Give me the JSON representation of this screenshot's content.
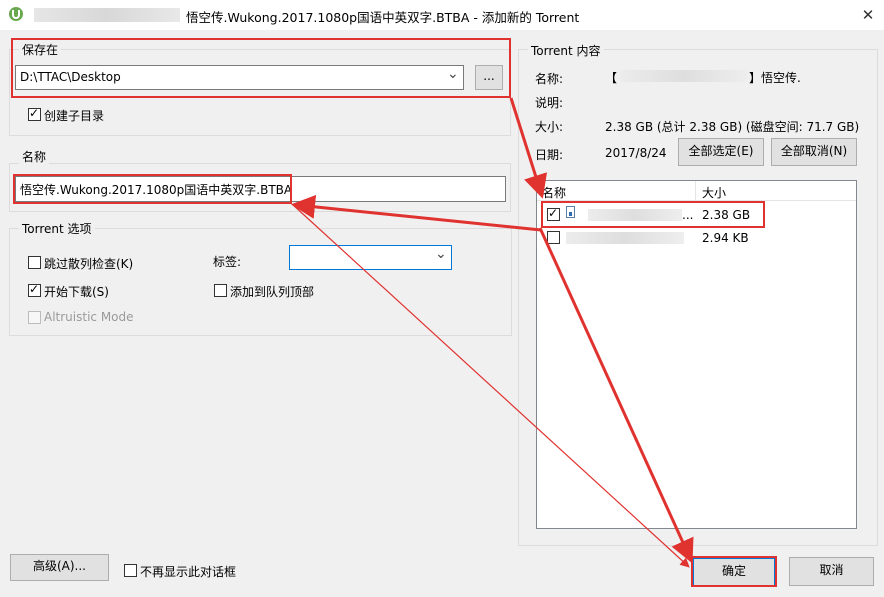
{
  "window": {
    "title": "悟空传.Wukong.2017.1080p国语中英双字.BTBA - 添加新的 Torrent",
    "close_glyph": "✕"
  },
  "save_in": {
    "legend": "保存在",
    "path": "D:\\TTAC\\Desktop",
    "browse_label": "...",
    "dropdown_glyph": "⌄",
    "create_subdir_label": "创建子目录",
    "create_subdir_checked": true
  },
  "name_section": {
    "legend": "名称",
    "value": "悟空传.Wukong.2017.1080p国语中英双字.BTBA"
  },
  "options": {
    "legend": "Torrent 选项",
    "skip_check_label": "跳过散列检查(K)",
    "skip_check_checked": false,
    "start_download_label": "开始下载(S)",
    "start_download_checked": true,
    "altruistic_label": "Altruistic Mode",
    "altruistic_checked": false,
    "tag_label": "标签:",
    "tag_value": "",
    "add_top_label": "添加到队列顶部",
    "add_top_checked": false
  },
  "content": {
    "legend": "Torrent 内容",
    "name_label": "名称:",
    "name_bracket_open": "【",
    "name_bracket_close": "】悟空传.",
    "desc_label": "说明:",
    "desc_value": "",
    "size_label": "大小:",
    "size_value": "2.38 GB (总计 2.38 GB) (磁盘空间: 71.7 GB)",
    "date_label": "日期:",
    "date_value": "2017/8/24",
    "select_all_label": "全部选定(E)",
    "deselect_all_label": "全部取消(N)",
    "columns": {
      "name": "名称",
      "size": "大小"
    },
    "files": [
      {
        "name_suffix": "...",
        "size": "2.38 GB",
        "checked": true
      },
      {
        "name_suffix": "",
        "size": "2.94 KB",
        "checked": false
      }
    ]
  },
  "footer": {
    "advanced_label": "高级(A)...",
    "dont_show_label": "不再显示此对话框",
    "dont_show_checked": false,
    "ok_label": "确定",
    "cancel_label": "取消"
  },
  "colors": {
    "annotation_red": "#e0322f",
    "background": "#f0f0f0"
  }
}
